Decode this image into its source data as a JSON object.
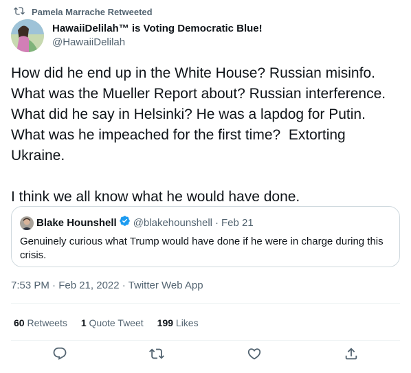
{
  "retweet_header": {
    "label": "Pamela Marrache Retweeted",
    "icon": "retweet-icon"
  },
  "author": {
    "display_name": "HawaiiDelilah™ is Voting Democratic Blue!",
    "handle": "@HawaiiDelilah"
  },
  "tweet": {
    "text": "How did he end up in the White House? Russian misinfo. What was the Mueller Report about? Russian interference. What did he say in Helsinki? He was a lapdog for Putin.  What was he impeached for the first time?  Extorting Ukraine.\n\nI think we all know what he would have done."
  },
  "quoted_tweet": {
    "author_name": "Blake Hounshell",
    "verified_icon": "verified-badge-icon",
    "handle": "@blakehounshell",
    "separator": "·",
    "date": "Feb 21",
    "text": "Genuinely curious what Trump would have done if he were in charge during this crisis."
  },
  "meta": {
    "text": "7:53 PM · Feb 21, 2022 · Twitter Web App"
  },
  "stats": [
    {
      "count": "60",
      "label": "Retweets"
    },
    {
      "count": "1",
      "label": "Quote Tweet"
    },
    {
      "count": "199",
      "label": "Likes"
    }
  ],
  "actions": [
    "reply-icon",
    "retweet-icon",
    "like-icon",
    "share-icon"
  ],
  "colors": {
    "text": "#0f1419",
    "secondary": "#536471",
    "border": "#cfd9de",
    "verified": "#1d9bf0"
  }
}
